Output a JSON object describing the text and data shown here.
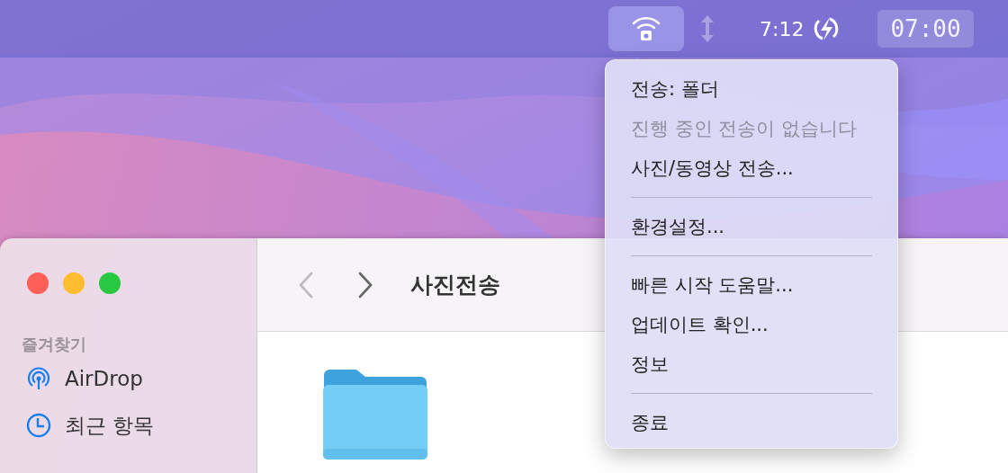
{
  "menubar": {
    "transfer_status": {
      "selected": true
    },
    "battery_time": "7:12",
    "clock": "07:00"
  },
  "menu": {
    "items": [
      {
        "kind": "item",
        "label": "전송: 폴더",
        "disabled": false
      },
      {
        "kind": "item",
        "label": "진행 중인 전송이 없습니다",
        "disabled": true
      },
      {
        "kind": "item",
        "label": "사진/동영상 전송...",
        "disabled": false
      },
      {
        "kind": "separator"
      },
      {
        "kind": "item",
        "label": "환경설정...",
        "disabled": false
      },
      {
        "kind": "separator"
      },
      {
        "kind": "item",
        "label": "빠른 시작 도움말...",
        "disabled": false
      },
      {
        "kind": "item",
        "label": "업데이트 확인...",
        "disabled": false
      },
      {
        "kind": "item",
        "label": "정보",
        "disabled": false
      },
      {
        "kind": "separator"
      },
      {
        "kind": "item",
        "label": "종료",
        "disabled": false
      }
    ]
  },
  "finder": {
    "title": "사진전송",
    "sidebar": {
      "section": "즐겨찾기",
      "items": [
        {
          "kind": "airdrop",
          "label": "AirDrop"
        },
        {
          "kind": "recent",
          "label": "최근 항목"
        }
      ]
    },
    "files": [
      {
        "kind": "folder"
      }
    ]
  }
}
